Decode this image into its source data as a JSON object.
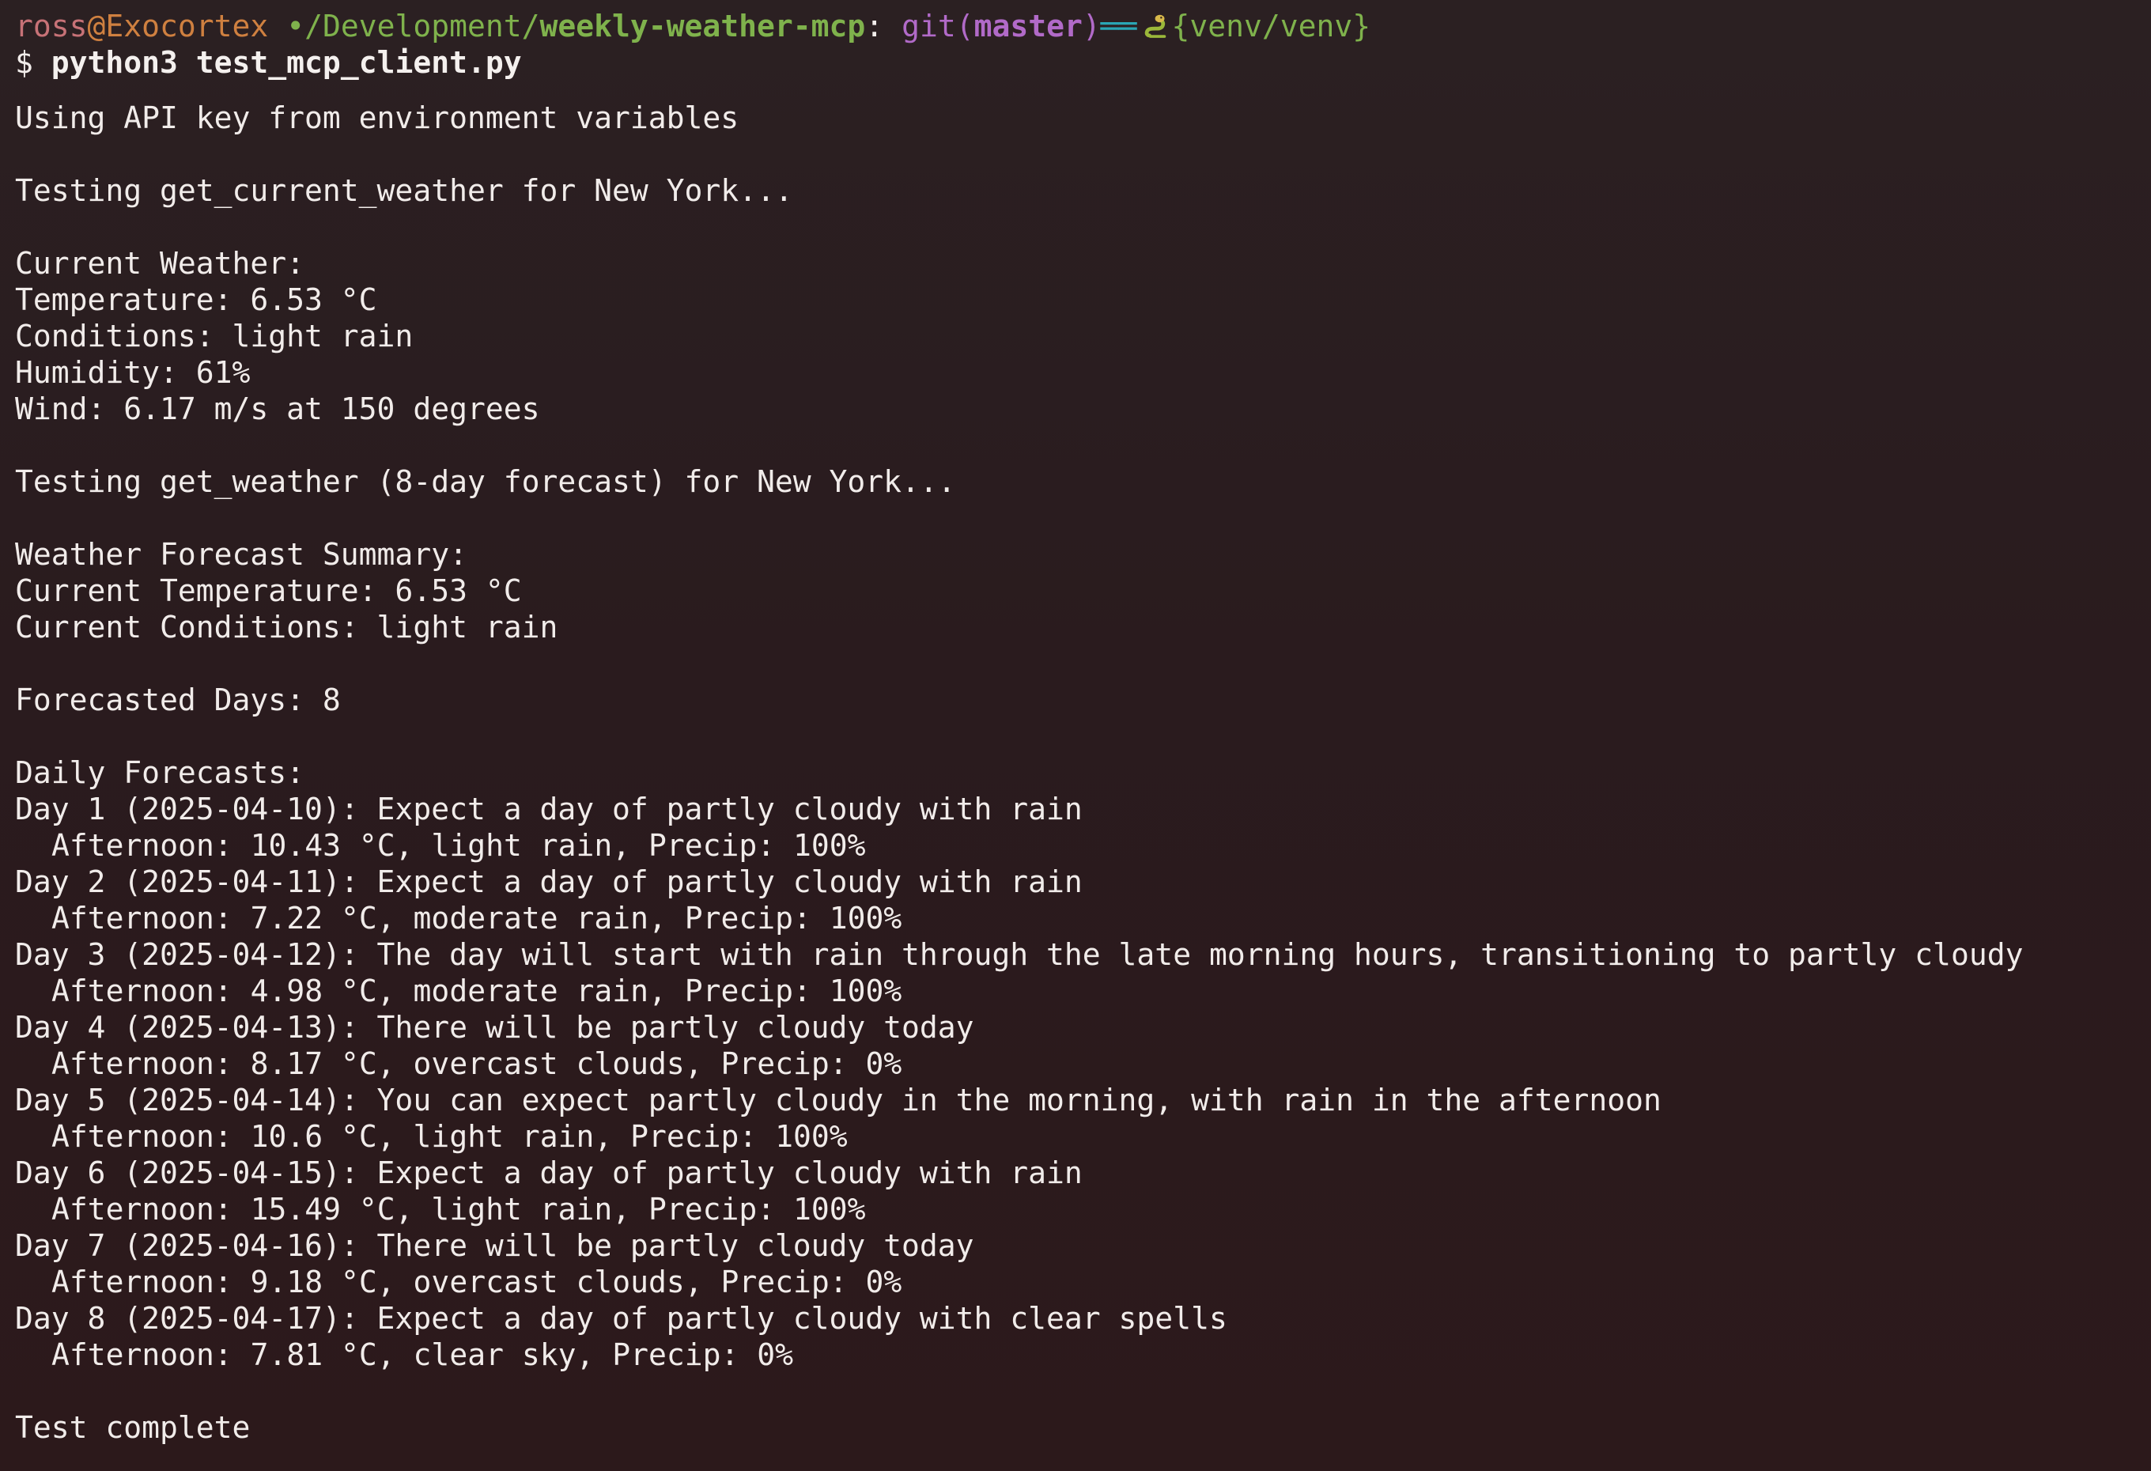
{
  "prompt": {
    "user": "ross",
    "at": "@",
    "host": "Exocortex",
    "path_prefix": " •/Development/",
    "path_dir": "weekly-weather-mcp",
    "colon": ":",
    "git_label": " git(",
    "branch": "master",
    "git_close": ")",
    "clean_marker": "══",
    "venv_icon": "python-snake-icon",
    "venv": "{venv/venv}",
    "dollar": "$ ",
    "command": "python3 test_mcp_client.py"
  },
  "output": {
    "api_key": "Using API key from environment variables",
    "test_current": "Testing get_current_weather for New York...",
    "current_header": "Current Weather:",
    "temperature": "Temperature: 6.53 °C",
    "conditions": "Conditions: light rain",
    "humidity": "Humidity: 61%",
    "wind": "Wind: 6.17 m/s at 150 degrees",
    "test_forecast": "Testing get_weather (8-day forecast) for New York...",
    "summary_header": "Weather Forecast Summary:",
    "current_temp": "Current Temperature: 6.53 °C",
    "current_conditions": "Current Conditions: light rain",
    "forecasted_days": "Forecasted Days: 8",
    "daily_header": "Daily Forecasts:",
    "days": [
      {
        "summary": "Day 1 (2025-04-10): Expect a day of partly cloudy with rain",
        "afternoon": "Afternoon: 10.43 °C, light rain, Precip: 100%"
      },
      {
        "summary": "Day 2 (2025-04-11): Expect a day of partly cloudy with rain",
        "afternoon": "Afternoon: 7.22 °C, moderate rain, Precip: 100%"
      },
      {
        "summary": "Day 3 (2025-04-12): The day will start with rain through the late morning hours, transitioning to partly cloudy",
        "afternoon": "Afternoon: 4.98 °C, moderate rain, Precip: 100%"
      },
      {
        "summary": "Day 4 (2025-04-13): There will be partly cloudy today",
        "afternoon": "Afternoon: 8.17 °C, overcast clouds, Precip: 0%"
      },
      {
        "summary": "Day 5 (2025-04-14): You can expect partly cloudy in the morning, with rain in the afternoon",
        "afternoon": "Afternoon: 10.6 °C, light rain, Precip: 100%"
      },
      {
        "summary": "Day 6 (2025-04-15): Expect a day of partly cloudy with rain",
        "afternoon": "Afternoon: 15.49 °C, light rain, Precip: 100%"
      },
      {
        "summary": "Day 7 (2025-04-16): There will be partly cloudy today",
        "afternoon": "Afternoon: 9.18 °C, overcast clouds, Precip: 0%"
      },
      {
        "summary": "Day 8 (2025-04-17): Expect a day of partly cloudy with clear spells",
        "afternoon": "Afternoon: 7.81 °C, clear sky, Precip: 0%"
      }
    ],
    "complete": "Test complete"
  },
  "colors": {
    "background": "#2a1b1e",
    "text": "#f1ecea",
    "user": "#c77277",
    "host": "#cf8040",
    "path": "#7fb24c",
    "git": "#b16ac8",
    "clean": "#2aa6b5"
  }
}
